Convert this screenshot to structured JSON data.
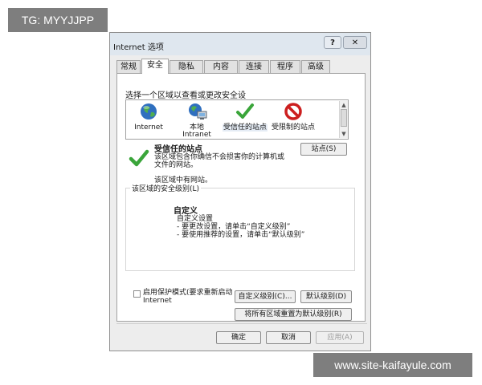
{
  "overlays": {
    "top_left_tag": "TG: MYYJJPP",
    "bottom_right_tag": "www.site-kaifayule.com"
  },
  "dialog": {
    "title": "Internet 选项",
    "help_label": "?",
    "close_label": "✕",
    "tabs": [
      "常规",
      "安全",
      "隐私",
      "内容",
      "连接",
      "程序",
      "高级"
    ],
    "active_tab": "安全"
  },
  "security": {
    "zone_prompt": "选择一个区域以查看或更改安全设",
    "zones": [
      {
        "label": "Internet",
        "icon": "globe-icon"
      },
      {
        "label": "本地 Intranet",
        "icon": "local-intranet-icon"
      },
      {
        "label": "受信任的站点",
        "icon": "trusted-check-icon"
      },
      {
        "label": "受限制的站点",
        "icon": "restricted-icon"
      }
    ],
    "selected_zone_title": "受信任的站点",
    "selected_zone_desc": "该区域包含你确信不会损害你的计算机或文件的网站。",
    "sites_button": "站点(S)",
    "zone_note": "该区域中有网站。",
    "level_group_title": "该区域的安全级别(L)",
    "custom_title": "自定义",
    "custom_desc": [
      "自定义设置",
      "- 要更改设置，请单击“自定义级别”",
      "- 要使用推荐的设置，请单击“默认级别”"
    ],
    "protected_mode_label": "启用保护模式(要求重新启动 Internet",
    "custom_level_button": "自定义级别(C)...",
    "default_level_button": "默认级别(D)",
    "reset_all_button": "将所有区域重置为默认级别(R)"
  },
  "footer": {
    "ok": "确定",
    "cancel": "取消",
    "apply": "应用(A)"
  },
  "colors": {
    "check_green": "#3aa53a",
    "restricted_red": "#cc1f1f",
    "globe_blue": "#2f6fbf"
  }
}
